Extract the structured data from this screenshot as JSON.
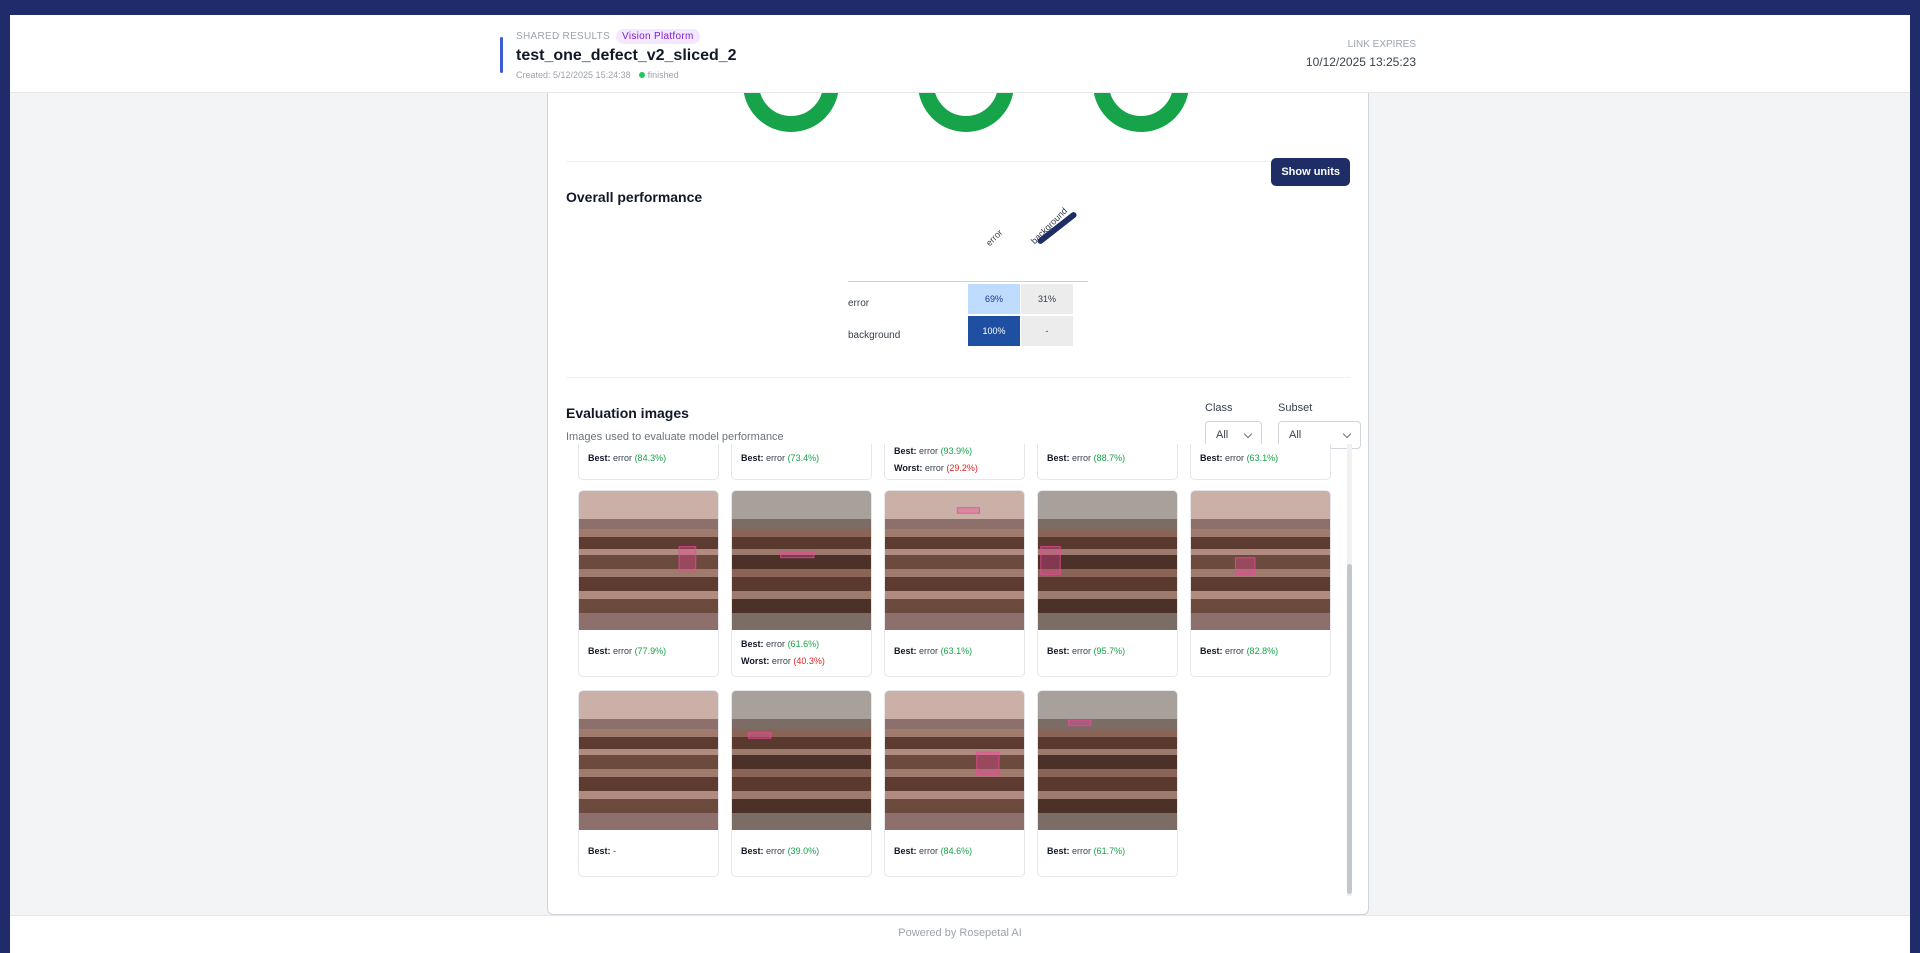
{
  "header": {
    "eyebrow": "SHARED RESULTS",
    "badge": "Vision Platform",
    "title": "test_one_defect_v2_sliced_2",
    "created": "Created: 5/12/2025 15:24:38",
    "status": "finished",
    "expires_label": "LINK EXPIRES",
    "expires_value": "10/12/2025 13:25:23"
  },
  "performance": {
    "title": "Overall performance",
    "show_units_label": "Show units",
    "columns": [
      "error",
      "background"
    ],
    "rows": [
      {
        "label": "error",
        "cells": [
          "69%",
          "31%"
        ]
      },
      {
        "label": "background",
        "cells": [
          "100%",
          "-"
        ]
      }
    ]
  },
  "evaluation": {
    "title": "Evaluation images",
    "subtitle": "Images used to evaluate model performance",
    "class_label": "Class",
    "class_value": "All",
    "subset_label": "Subset",
    "subset_value": "All",
    "best_label": "Best:",
    "worst_label": "Worst:",
    "top_row": [
      {
        "best_class": "error",
        "best_pct": "(84.3%)"
      },
      {
        "best_class": "error",
        "best_pct": "(73.4%)"
      },
      {
        "best_class": "error",
        "best_pct": "(93.9%)",
        "worst_class": "error",
        "worst_pct": "(29.2%)"
      },
      {
        "best_class": "error",
        "best_pct": "(88.7%)"
      },
      {
        "best_class": "error",
        "best_pct": "(63.1%)"
      }
    ],
    "mid_row": [
      {
        "best_class": "error",
        "best_pct": "(77.9%)"
      },
      {
        "best_class": "error",
        "best_pct": "(61.6%)",
        "worst_class": "error",
        "worst_pct": "(40.3%)"
      },
      {
        "best_class": "error",
        "best_pct": "(63.1%)"
      },
      {
        "best_class": "error",
        "best_pct": "(95.7%)"
      },
      {
        "best_class": "error",
        "best_pct": "(82.8%)"
      }
    ],
    "bottom_row": [
      {
        "best_class": "-",
        "best_pct": ""
      },
      {
        "best_class": "error",
        "best_pct": "(39.0%)"
      },
      {
        "best_class": "error",
        "best_pct": "(84.6%)"
      },
      {
        "best_class": "error",
        "best_pct": "(61.7%)"
      }
    ]
  },
  "footer": {
    "text": "Powered by Rosepetal AI"
  }
}
